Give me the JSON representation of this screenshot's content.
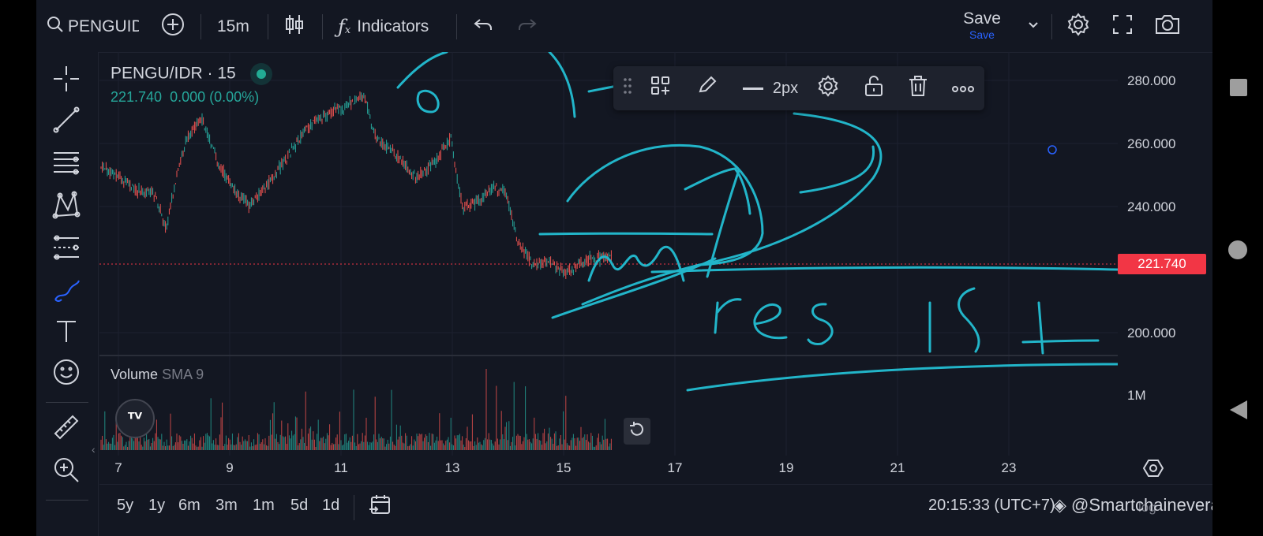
{
  "topbar": {
    "symbol": "PENGUIDR",
    "interval": "15m",
    "indicators_label": "Indicators",
    "save_label": "Save",
    "save_sub": "Save"
  },
  "legend": {
    "title": "PENGU/IDR · 15",
    "values": "221.740  0.000 (0.00%)"
  },
  "volume": {
    "title": "Volume",
    "sma": "SMA 9",
    "axis_label": "1M"
  },
  "price_axis": {
    "labels": [
      "280.000",
      "260.000",
      "240.000",
      "200.000"
    ],
    "current_price": "221.740"
  },
  "time_axis": {
    "labels": [
      "7",
      "9",
      "11",
      "13",
      "15",
      "17",
      "19",
      "21",
      "23"
    ]
  },
  "drawing_toolbar": {
    "width_label": "2px"
  },
  "bottombar": {
    "ranges": [
      "5y",
      "1y",
      "6m",
      "3m",
      "1m",
      "5d",
      "1d"
    ],
    "clock": "20:15:33 (UTC+7)",
    "watermark": "@Smartchainevera",
    "log_label": "log"
  },
  "colors": {
    "background": "#131722",
    "up": "#26a69a",
    "down": "#ef5350",
    "drawing": "#22b5c9",
    "price_tag": "#f23645",
    "accent": "#2962ff"
  },
  "handwriting_text": "resist",
  "icons": [
    "search-icon",
    "plus-circle-icon",
    "candles-icon",
    "fx-icon",
    "undo-icon",
    "redo-icon",
    "chevron-down-icon",
    "gear-icon",
    "fullscreen-icon",
    "camera-icon",
    "crosshair-icon",
    "trendline-icon",
    "fib-icon",
    "pattern-icon",
    "prediction-icon",
    "brush-icon",
    "text-icon",
    "emoji-icon",
    "ruler-icon",
    "zoom-icon",
    "lock-icon",
    "trash-icon",
    "more-icon",
    "calendar-icon",
    "reset-icon"
  ]
}
